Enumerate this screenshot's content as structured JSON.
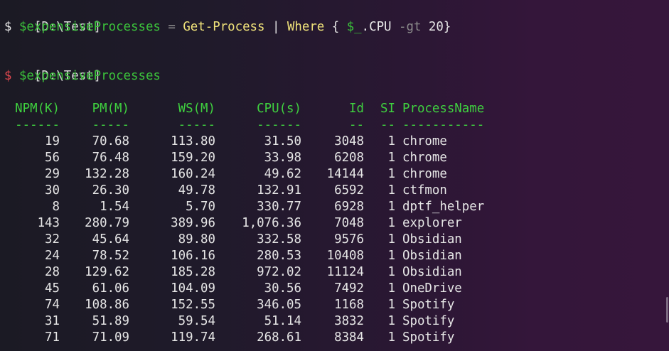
{
  "session": {
    "prompt1": {
      "path": "[D:\\Test]",
      "symbol": "$ ",
      "variable": "$expensiveProcesses",
      "assign": " = ",
      "cmdlet": "Get-Process",
      "pipe": " | ",
      "where": "Where",
      "open_brace": " { ",
      "pipe_var": "$_",
      "prop": ".CPU ",
      "operator": "-gt",
      "value": " 20}"
    },
    "prompt2": {
      "path": "[D:\\Test]",
      "symbol": "$ ",
      "variable": "$expensiveProcesses",
      "symbol_color": "#e0484e"
    }
  },
  "table": {
    "headers": [
      "NPM(K)",
      "PM(M)",
      "WS(M)",
      "CPU(s)",
      "Id",
      "SI",
      "ProcessName"
    ],
    "underlines": [
      "------",
      "-----",
      "-----",
      "------",
      "--",
      "--",
      "-----------"
    ],
    "rows": [
      [
        "19",
        "70.68",
        "113.80",
        "31.50",
        "3048",
        "1",
        "chrome"
      ],
      [
        "56",
        "76.48",
        "159.20",
        "33.98",
        "6208",
        "1",
        "chrome"
      ],
      [
        "29",
        "132.28",
        "160.24",
        "49.62",
        "14144",
        "1",
        "chrome"
      ],
      [
        "30",
        "26.30",
        "49.78",
        "132.91",
        "6592",
        "1",
        "ctfmon"
      ],
      [
        "8",
        "1.54",
        "5.70",
        "330.77",
        "6928",
        "1",
        "dptf_helper"
      ],
      [
        "143",
        "280.79",
        "389.96",
        "1,076.36",
        "7048",
        "1",
        "explorer"
      ],
      [
        "32",
        "45.64",
        "89.80",
        "332.58",
        "9576",
        "1",
        "Obsidian"
      ],
      [
        "24",
        "78.52",
        "106.16",
        "280.53",
        "10408",
        "1",
        "Obsidian"
      ],
      [
        "28",
        "129.62",
        "185.28",
        "972.02",
        "11124",
        "1",
        "Obsidian"
      ],
      [
        "45",
        "61.06",
        "104.09",
        "30.56",
        "7492",
        "1",
        "OneDrive"
      ],
      [
        "74",
        "108.86",
        "152.55",
        "346.05",
        "1168",
        "1",
        "Spotify"
      ],
      [
        "31",
        "51.89",
        "59.54",
        "51.14",
        "3832",
        "1",
        "Spotify"
      ],
      [
        "71",
        "71.09",
        "119.74",
        "268.61",
        "8384",
        "1",
        "Spotify"
      ]
    ]
  },
  "colors": {
    "header_green": "#3fd13f",
    "variable_green": "#3bc13b",
    "cmdlet_yellow": "#f0e27a",
    "error_red": "#e0484e"
  }
}
